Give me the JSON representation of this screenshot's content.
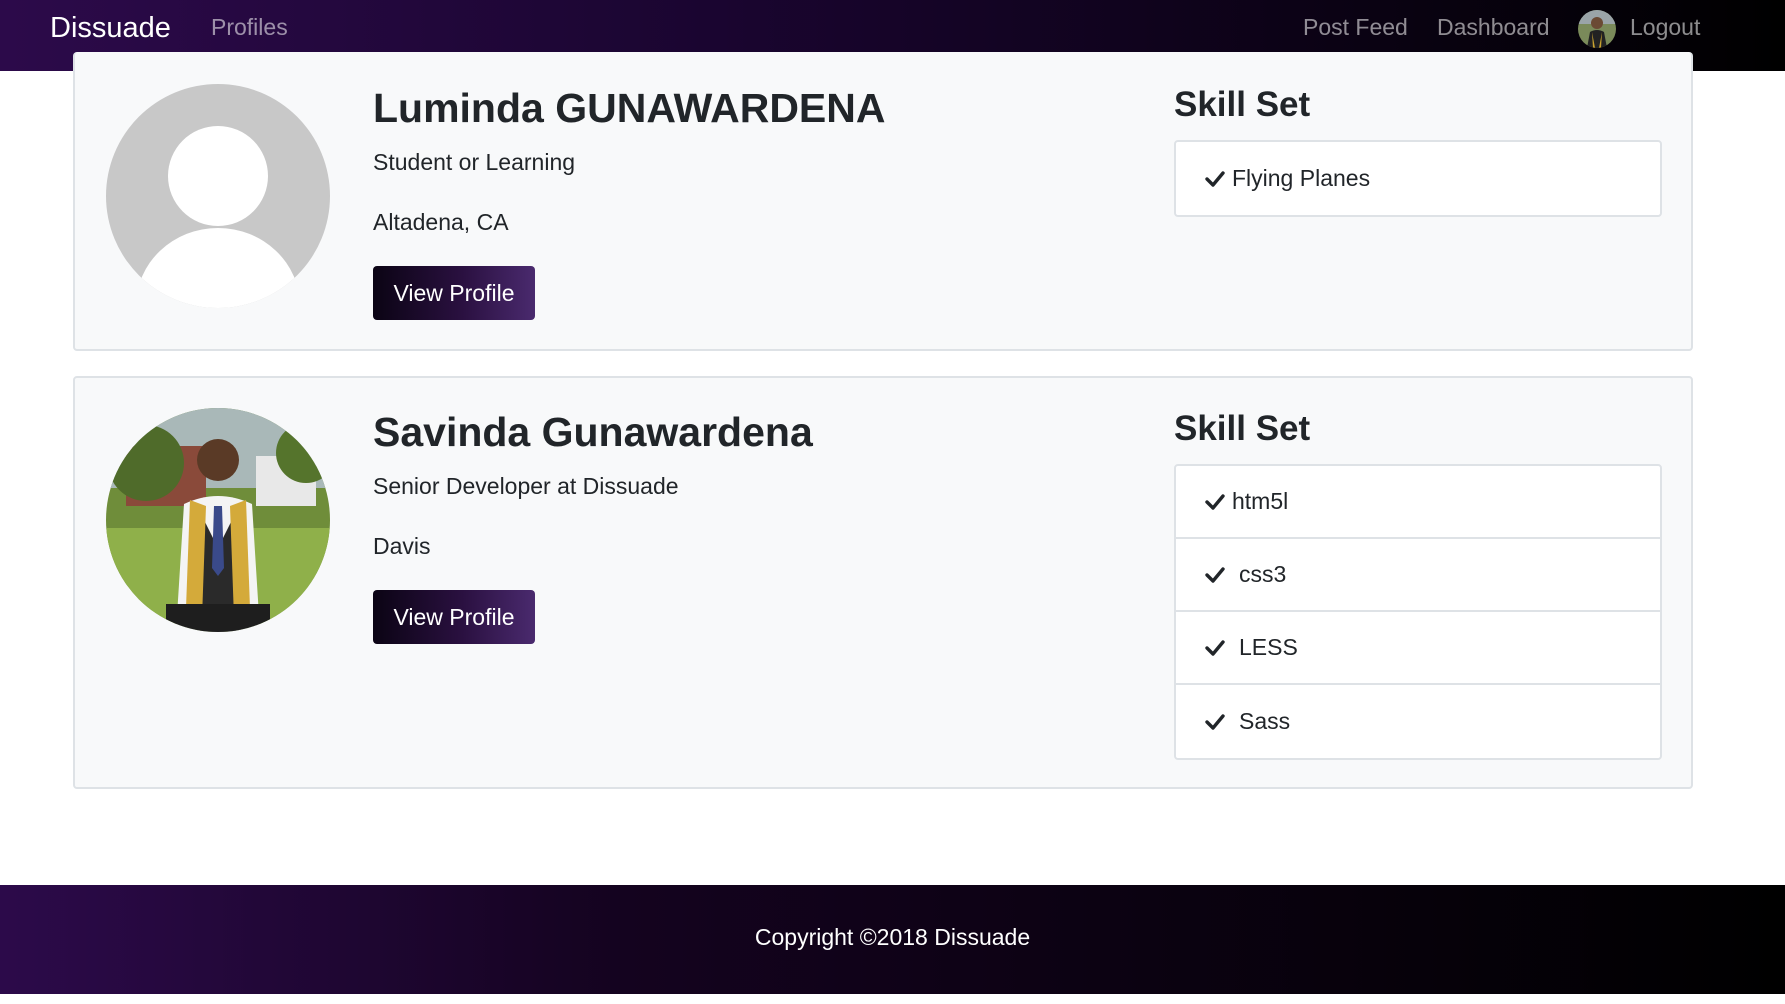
{
  "navbar": {
    "brand": "Dissuade",
    "links": {
      "profiles": "Profiles",
      "post_feed": "Post Feed",
      "dashboard": "Dashboard",
      "logout": "Logout"
    }
  },
  "profiles": [
    {
      "name": "Luminda GUNAWARDENA",
      "status": "Student or Learning",
      "location": "Altadena, CA",
      "button_label": "View Profile",
      "skills_heading": "Skill Set",
      "skills": [
        "Flying Planes"
      ]
    },
    {
      "name": "Savinda Gunawardena",
      "status": "Senior Developer at Dissuade",
      "location": "Davis",
      "button_label": "View Profile",
      "skills_heading": "Skill Set",
      "skills": [
        "htm5l",
        "css3",
        "LESS",
        "Sass"
      ]
    }
  ],
  "footer": {
    "copyright": "Copyright ©2018 Dissuade"
  },
  "colors": {
    "nav_gradient_start": "#2c0a4a",
    "nav_gradient_end": "#000000",
    "card_background": "#f8f9fa",
    "button_gradient_end": "#4a2a6e"
  },
  "icons": {
    "skill_bullet": "check-icon",
    "default_avatar": "person-silhouette-icon"
  }
}
